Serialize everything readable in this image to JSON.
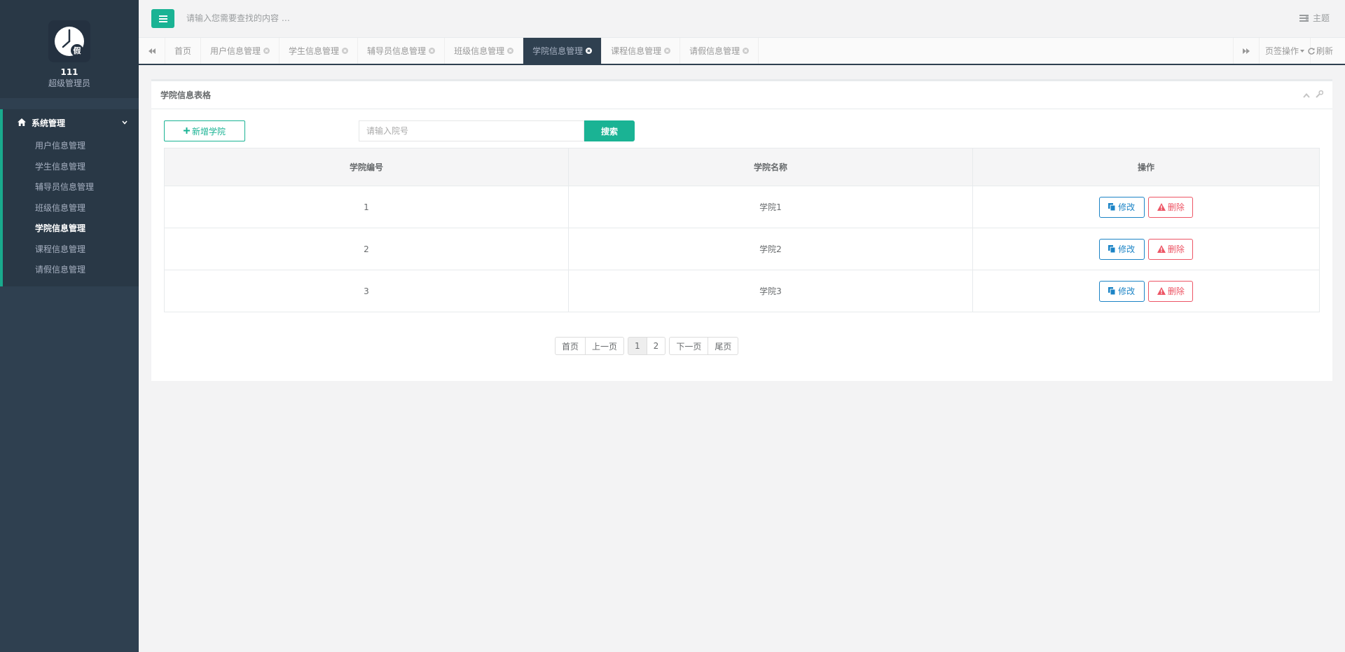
{
  "sidebar": {
    "user_name": "111",
    "user_role": "超级管理员",
    "logo_text": "假",
    "group_label": "系统管理",
    "items": [
      {
        "label": "用户信息管理",
        "active": false
      },
      {
        "label": "学生信息管理",
        "active": false
      },
      {
        "label": "辅导员信息管理",
        "active": false
      },
      {
        "label": "班级信息管理",
        "active": false
      },
      {
        "label": "学院信息管理",
        "active": true
      },
      {
        "label": "课程信息管理",
        "active": false
      },
      {
        "label": "请假信息管理",
        "active": false
      }
    ]
  },
  "topbar": {
    "search_placeholder": "请输入您需要查找的内容 …",
    "theme_label": "主题"
  },
  "tabsbar": {
    "tabs": [
      {
        "label": "首页",
        "closable": false,
        "active": false
      },
      {
        "label": "用户信息管理",
        "closable": true,
        "active": false
      },
      {
        "label": "学生信息管理",
        "closable": true,
        "active": false
      },
      {
        "label": "辅导员信息管理",
        "closable": true,
        "active": false
      },
      {
        "label": "班级信息管理",
        "closable": true,
        "active": false
      },
      {
        "label": "学院信息管理",
        "closable": true,
        "active": true
      },
      {
        "label": "课程信息管理",
        "closable": true,
        "active": false
      },
      {
        "label": "请假信息管理",
        "closable": true,
        "active": false
      }
    ],
    "ops_label": "页签操作",
    "refresh_label": "刷新"
  },
  "panel": {
    "title": "学院信息表格",
    "add_label": "新增学院",
    "search_placeholder": "请输入院号",
    "search_label": "搜索",
    "columns": [
      "学院编号",
      "学院名称",
      "操作"
    ],
    "rows": [
      {
        "id": "1",
        "name": "学院1"
      },
      {
        "id": "2",
        "name": "学院2"
      },
      {
        "id": "3",
        "name": "学院3"
      }
    ],
    "edit_label": "修改",
    "delete_label": "删除"
  },
  "pagination": {
    "first": "首页",
    "prev": "上一页",
    "pages": [
      "1",
      "2"
    ],
    "current": "1",
    "next": "下一页",
    "last": "尾页"
  },
  "colors": {
    "sidebar_bg": "#2f4050",
    "primary": "#1ab394",
    "edit": "#1c84c6",
    "delete": "#ed5565"
  }
}
